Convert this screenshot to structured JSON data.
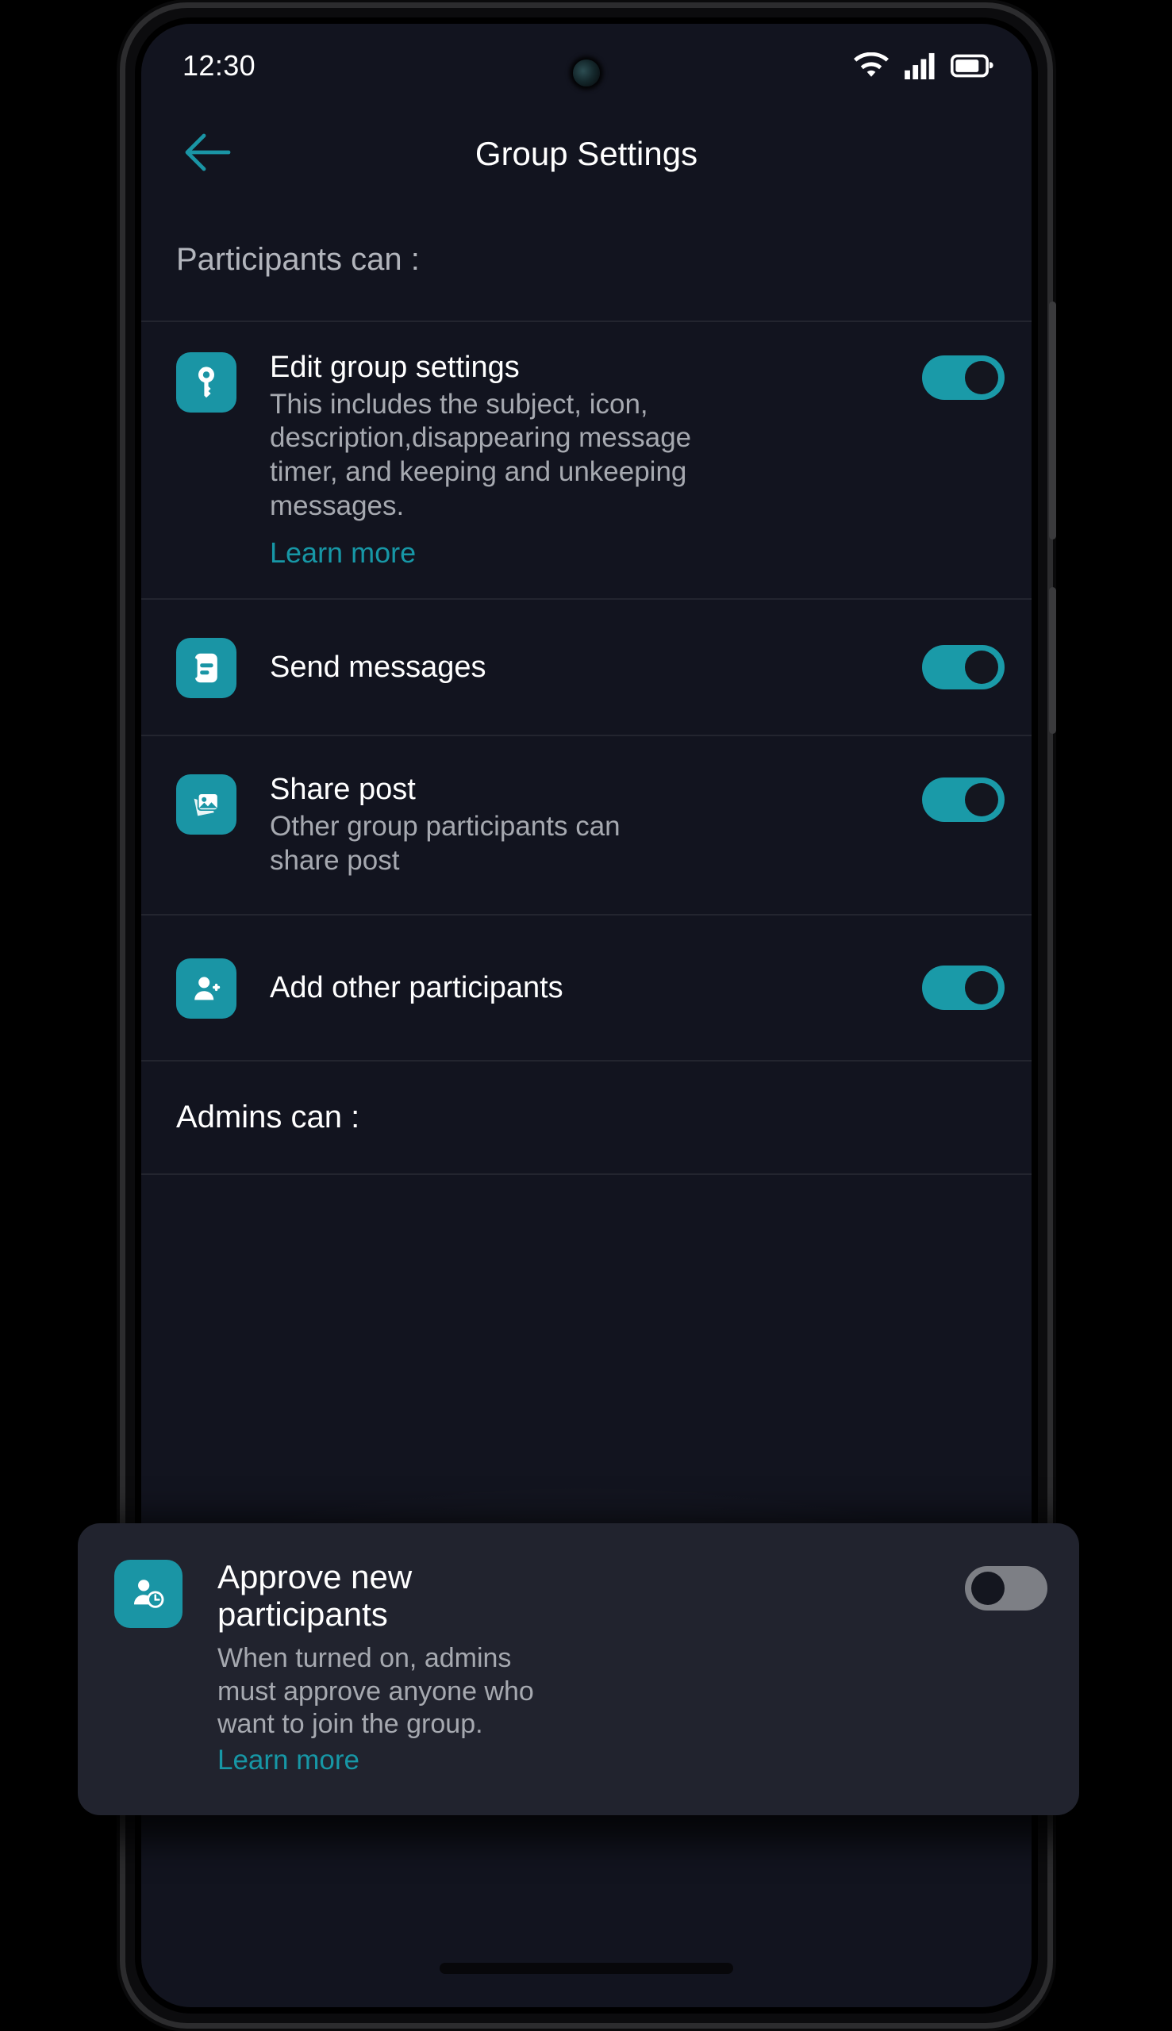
{
  "status_bar": {
    "time": "12:30",
    "icons": [
      "wifi-icon",
      "cellular-signal-icon",
      "battery-icon"
    ]
  },
  "app_bar": {
    "back_icon": "back-arrow-icon",
    "title": "Group Settings"
  },
  "colors": {
    "screen_bg": "#12141f",
    "accent_teal": "#1a95a5",
    "link_teal": "#1797a6",
    "toggle_on": "#1a9aa8",
    "toggle_off": "#7d7f85",
    "card_bg": "#21232e",
    "title_text": "#ffffff",
    "sub_text": "#a6a9b0",
    "divider": "#23252f"
  },
  "sections": [
    {
      "heading": "Participants can :",
      "rows": [
        {
          "icon": "key-icon",
          "title": "Edit group settings",
          "subtitle": "This includes the subject, icon, description,disappearing message timer, and keeping and unkeeping messages.",
          "link": "Learn more",
          "toggle": "on"
        },
        {
          "icon": "message-document-icon",
          "title": "Send messages",
          "subtitle": "",
          "link": "",
          "toggle": "on"
        },
        {
          "icon": "image-stack-icon",
          "title": "Share post",
          "subtitle": "Other group participants can share post",
          "link": "",
          "toggle": "on"
        },
        {
          "icon": "person-add-icon",
          "title": "Add other participants",
          "subtitle": "",
          "link": "",
          "toggle": "on"
        }
      ]
    },
    {
      "heading": "Admins can :",
      "rows": []
    }
  ],
  "overlay_card": {
    "icon": "person-clock-icon",
    "title": "Approve new participants",
    "subtitle": "When turned on, admins must approve anyone who want to join the group.",
    "link": "Learn more",
    "toggle": "off"
  }
}
